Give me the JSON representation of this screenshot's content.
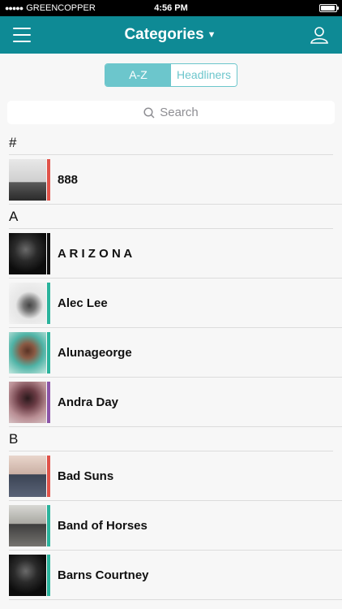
{
  "status_bar": {
    "carrier": "GREENCOPPER",
    "time": "4:56 PM",
    "battery_level": 0.95
  },
  "nav": {
    "title": "Categories",
    "menu_icon": "hamburger-icon",
    "profile_icon": "user-icon"
  },
  "segments": [
    {
      "label": "A-Z",
      "active": true
    },
    {
      "label": "Headliners",
      "active": false
    }
  ],
  "search": {
    "placeholder": "Search"
  },
  "colors": {
    "navbar": "#0e8a95",
    "segment_accent": "#6cc6cc",
    "red": "#e0534a",
    "teal": "#2bb39c",
    "purple": "#8b54a8",
    "black": "#111111"
  },
  "sections": [
    {
      "letter": "#",
      "items": [
        {
          "name": "888",
          "bar_color": "#e0534a",
          "photo": "bw"
        }
      ]
    },
    {
      "letter": "A",
      "items": [
        {
          "name": "A R I Z O N A",
          "bar_color": "#111111",
          "photo": "dark"
        },
        {
          "name": "Alec Lee",
          "bar_color": "#2bb39c",
          "photo": "light"
        },
        {
          "name": "Alunageorge",
          "bar_color": "#2bb39c",
          "photo": "teal"
        },
        {
          "name": "Andra Day",
          "bar_color": "#8b54a8",
          "photo": "mauve"
        }
      ]
    },
    {
      "letter": "B",
      "items": [
        {
          "name": "Bad Suns",
          "bar_color": "#e0534a",
          "photo": "band"
        },
        {
          "name": "Band of Horses",
          "bar_color": "#2bb39c",
          "photo": "grey"
        },
        {
          "name": "Barns Courtney",
          "bar_color": "#2bb39c",
          "photo": "dark"
        }
      ]
    }
  ]
}
